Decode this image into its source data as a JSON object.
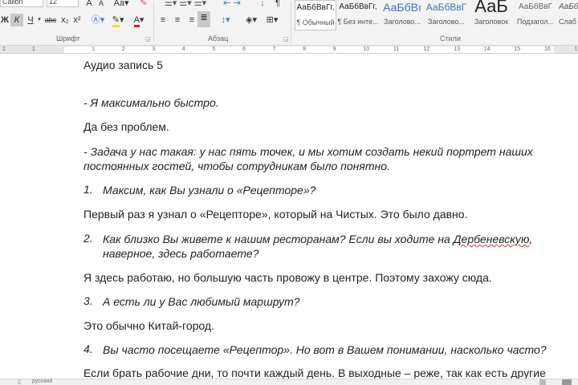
{
  "ribbon": {
    "font_name": "Calibri (Осно",
    "font_size": "12",
    "font_buttons": [
      "Ж",
      "К",
      "Ч",
      "abc",
      "x₂",
      "x²"
    ],
    "groups": {
      "font": "Шрифт",
      "paragraph": "Абзац",
      "styles": "Стили"
    },
    "styles": [
      {
        "preview": "АаБбВвГг,",
        "name": "¶ Обычный"
      },
      {
        "preview": "АаБбВвГг,",
        "name": "¶ Без инте..."
      },
      {
        "preview": "АаБбВı",
        "name": "Заголово..."
      },
      {
        "preview": "АаБбВвГ",
        "name": "Заголово..."
      },
      {
        "preview": "АаБ",
        "name": "Заголовок"
      },
      {
        "preview": "АаБбВвГ",
        "name": "Подзагол..."
      },
      {
        "preview": "АаБб",
        "name": "Слаб"
      }
    ],
    "colors": {
      "highlight": "#f7e11b",
      "font_color": "#e0201b"
    }
  },
  "ruler": {
    "ticks": [
      "2",
      "1",
      "1",
      "2",
      "3",
      "4",
      "5",
      "6",
      "7",
      "8",
      "9",
      "10",
      "11",
      "12",
      "13",
      "14",
      "15",
      "16",
      "17"
    ]
  },
  "document": {
    "title": "Аудио запись 5",
    "lines": [
      "- Я максимально быстро.",
      "Да без проблем.",
      "- Задача у нас такая: у нас пять точек, и мы хотим создать некий портрет наших",
      "постоянных гостей, чтобы сотрудникам было понятно.",
      "Первый раз я узнал о «Рецепторе», который на Чистых. Это было давно.",
      "Я здесь работаю, но большую часть провожу в центре. Поэтому захожу сюда.",
      "Это обычно Китай-город.",
      "Если брать рабочие дни, то почти каждый день. В выходные – реже, так как есть другие"
    ],
    "questions": [
      {
        "num": "1.",
        "text": "Максим, как Вы узнали о «Рецепторе»?"
      },
      {
        "num": "2.",
        "text_a": "Как близко Вы живете к нашим ресторанам? Если вы ходите на ",
        "text_sq": "Дербеневскую",
        "text_b": ",",
        "text2": "наверное, здесь работаете?"
      },
      {
        "num": "3.",
        "text": "А есть ли у Вас любимый маршрут?"
      },
      {
        "num": "4.",
        "text": "Вы часто посещаете «Рецептор». Но вот в Вашем понимании, насколько часто?"
      }
    ]
  },
  "status": {
    "language": "русский"
  }
}
